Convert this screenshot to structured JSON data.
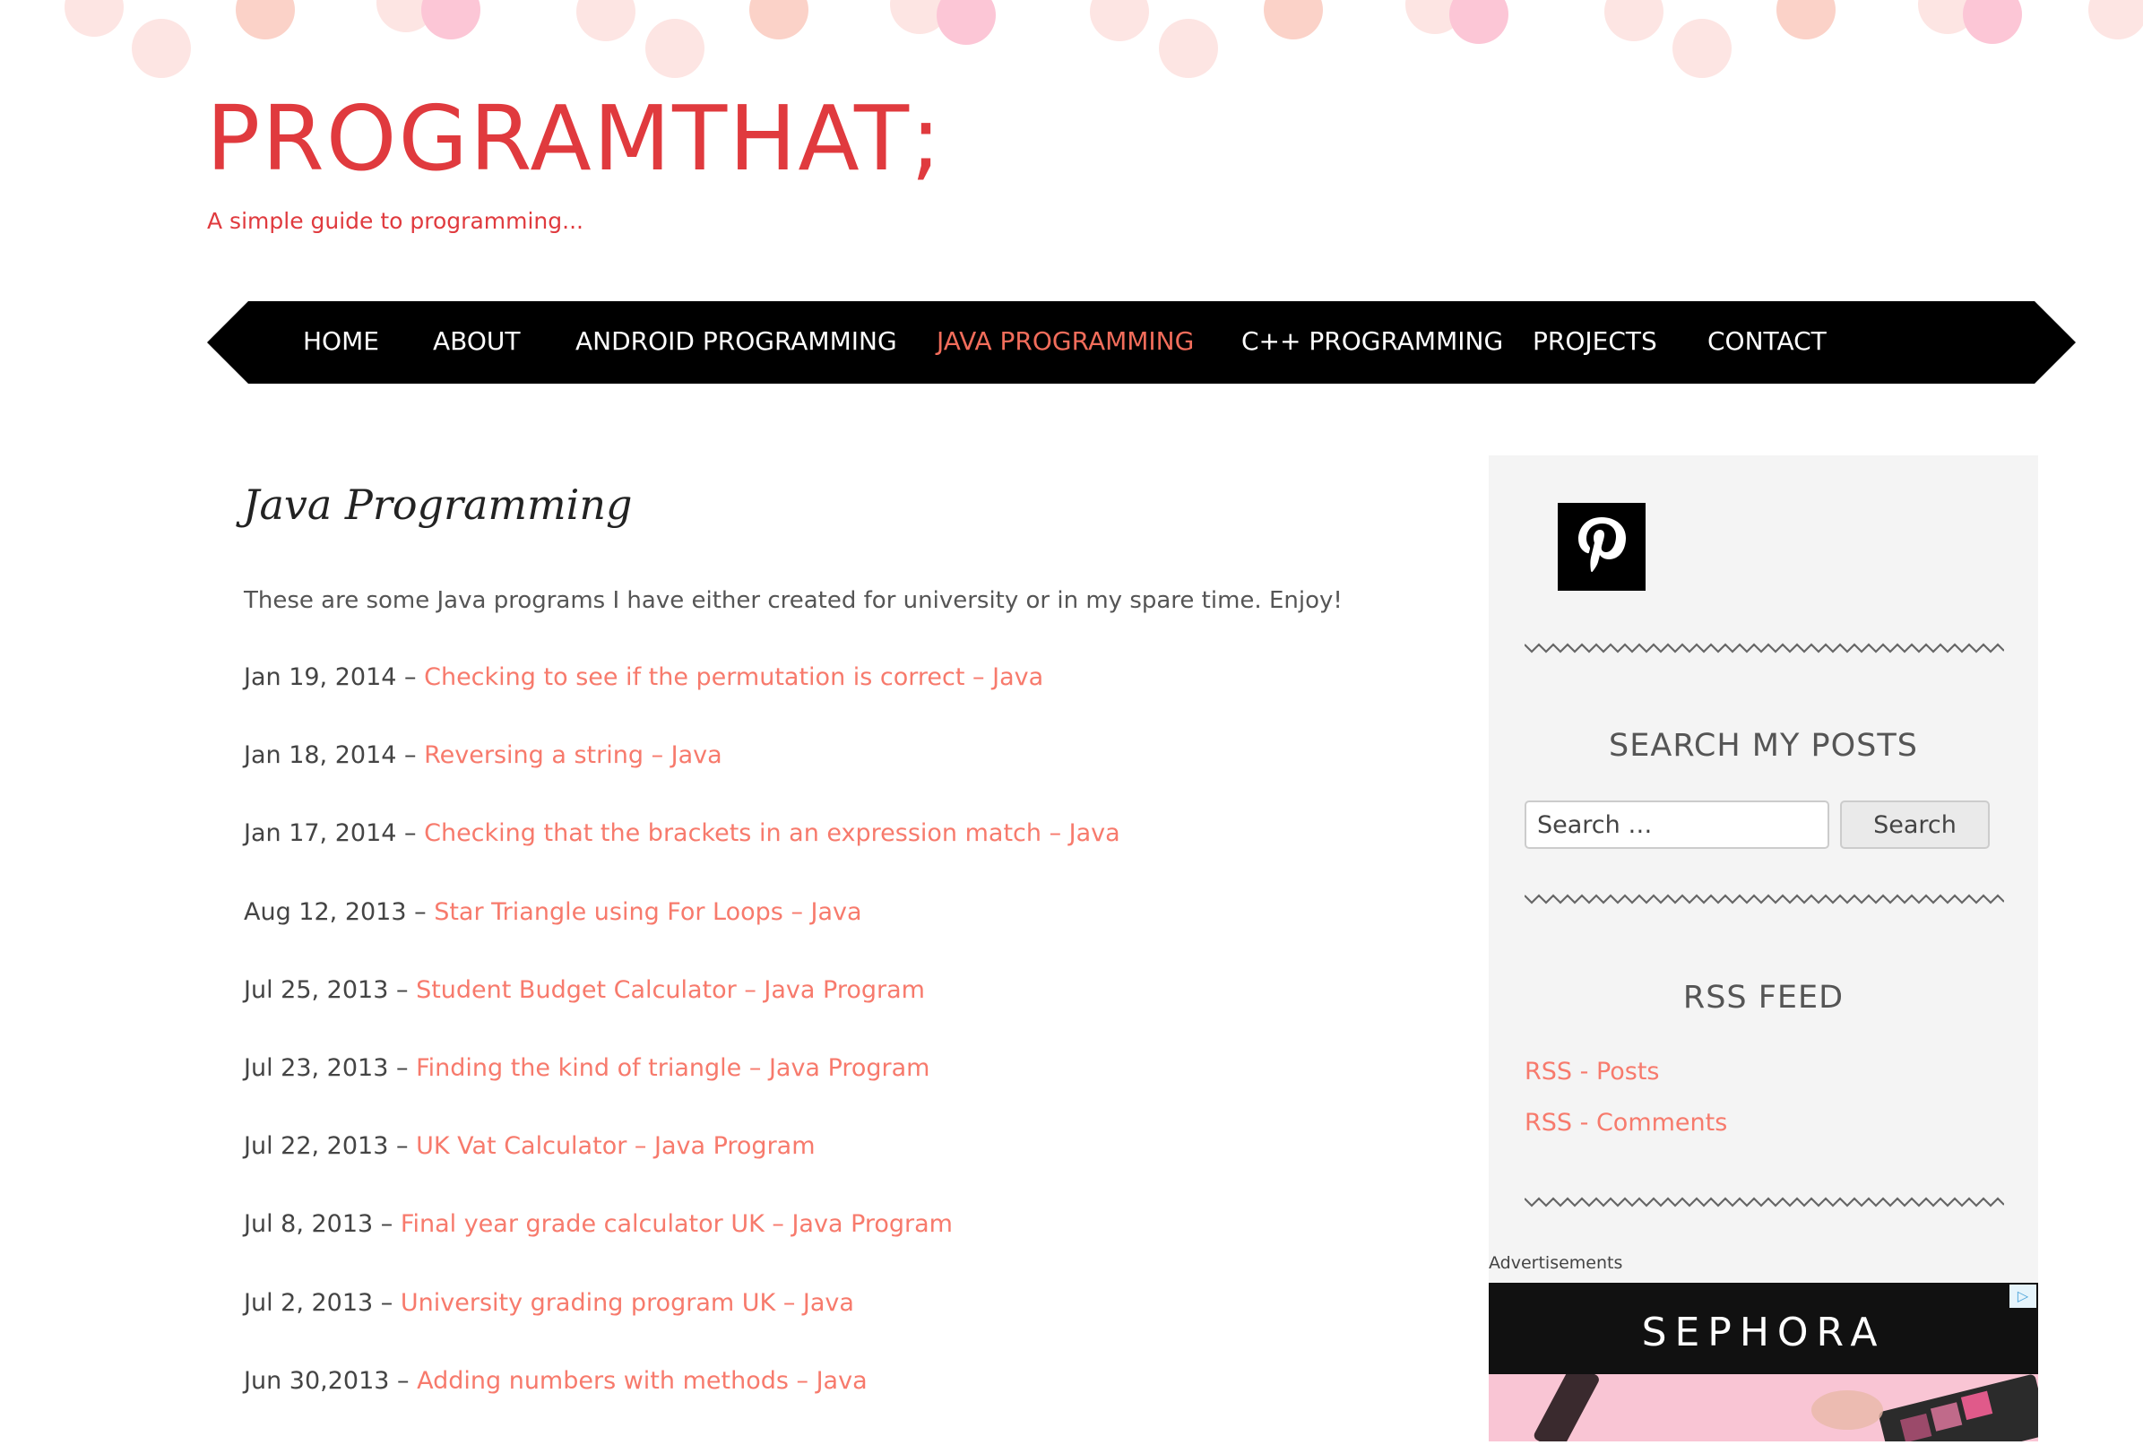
{
  "site": {
    "title": "PROGRAMTHAT;",
    "tagline": "A simple guide to programming..."
  },
  "nav": {
    "items": [
      {
        "label": "HOME"
      },
      {
        "label": "ABOUT"
      },
      {
        "label": "ANDROID PROGRAMMING"
      },
      {
        "label": "JAVA PROGRAMMING",
        "active": true
      },
      {
        "label": "C++ PROGRAMMING"
      },
      {
        "label": "PROJECTS"
      },
      {
        "label": "CONTACT"
      }
    ]
  },
  "page": {
    "title": "Java Programming",
    "intro": "These are some Java programs I have either created for university or in my spare time. Enjoy!",
    "posts": [
      {
        "date": "Jan 19, 2014 – ",
        "title": "Checking to see if the permutation is correct – Java"
      },
      {
        "date": "Jan 18, 2014 – ",
        "title": "Reversing a string – Java"
      },
      {
        "date": "Jan 17, 2014 – ",
        "title": "Checking that the brackets in an expression match – Java"
      },
      {
        "date": "Aug 12, 2013 – ",
        "title": "Star Triangle using For Loops – Java"
      },
      {
        "date": "Jul 25, 2013 – ",
        "title": "Student Budget Calculator – Java Program"
      },
      {
        "date": "Jul 23, 2013 – ",
        "title": "Finding the kind of triangle – Java Program"
      },
      {
        "date": "Jul 22, 2013 – ",
        "title": "UK Vat Calculator – Java Program"
      },
      {
        "date": "Jul 8, 2013 – ",
        "title": "Final year grade calculator UK – Java Program"
      },
      {
        "date": "Jul 2, 2013 – ",
        "title": "University grading program UK – Java"
      },
      {
        "date": "Jun 30,2013 – ",
        "title": "Adding numbers with methods – Java"
      }
    ]
  },
  "sidebar": {
    "social_icon": "pinterest-icon",
    "search": {
      "heading": "SEARCH MY POSTS",
      "placeholder": "Search …",
      "button": "Search"
    },
    "rss": {
      "heading": "RSS FEED",
      "links": [
        "RSS - Posts",
        "RSS - Comments"
      ]
    },
    "ads": {
      "label": "Advertisements",
      "brand": "SEPHORA"
    }
  },
  "colors": {
    "brand_red": "#e03a3e",
    "link_coral": "#f77a6c",
    "nav_bg": "#000000",
    "sidebar_bg": "#f4f4f4"
  }
}
